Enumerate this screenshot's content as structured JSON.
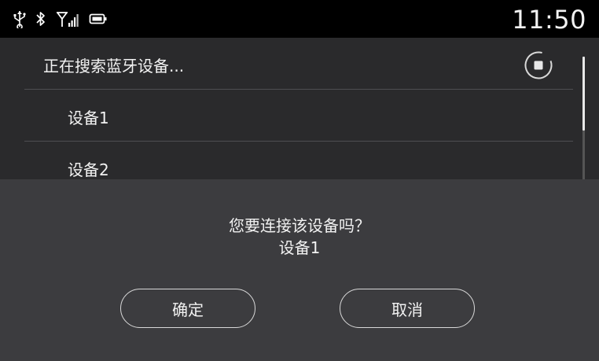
{
  "status_bar": {
    "time": "11:50",
    "icons": [
      "usb-icon",
      "bluetooth-icon",
      "signal-icon",
      "battery-icon"
    ]
  },
  "device_list": {
    "title": "正在搜索蓝牙设备...",
    "items": [
      {
        "label": "设备1"
      },
      {
        "label": "设备2"
      }
    ]
  },
  "dialog": {
    "question": "您要连接该设备吗？",
    "device_name": "设备1",
    "confirm_label": "确定",
    "cancel_label": "取消"
  }
}
